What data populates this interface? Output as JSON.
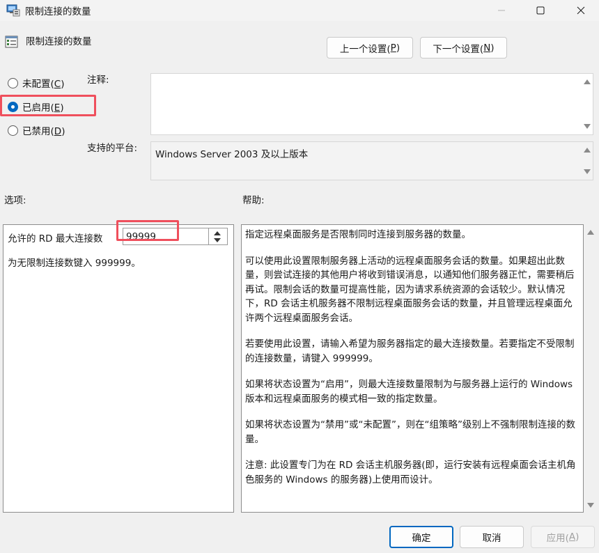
{
  "window": {
    "title": "限制连接的数量"
  },
  "header": {
    "policy_name": "限制连接的数量",
    "prev_button": {
      "label": "上一个设置(",
      "mnemonic": "P",
      "suffix": ")"
    },
    "next_button": {
      "label": "下一个设置(",
      "mnemonic": "N",
      "suffix": ")"
    }
  },
  "state": {
    "options": [
      {
        "label": "未配置(",
        "mnemonic": "C",
        "suffix": ")",
        "selected": false
      },
      {
        "label": "已启用(",
        "mnemonic": "E",
        "suffix": ")",
        "selected": true
      },
      {
        "label": "已禁用(",
        "mnemonic": "D",
        "suffix": ")",
        "selected": false
      }
    ]
  },
  "comment": {
    "label": "注释:",
    "value": ""
  },
  "platform": {
    "label": "支持的平台:",
    "value": "Windows Server 2003 及以上版本"
  },
  "options_section": {
    "label": "选项:",
    "max_connections_label": "允许的 RD 最大连接数",
    "max_connections_value": "99999",
    "hint": "为无限制连接数键入 999999。"
  },
  "help_section": {
    "label": "帮助:",
    "paragraphs": [
      "指定远程桌面服务是否限制同时连接到服务器的数量。",
      "可以使用此设置限制服务器上活动的远程桌面服务会话的数量。如果超出此数量，则尝试连接的其他用户将收到错误消息，以通知他们服务器正忙，需要稍后再试。限制会话的数量可提高性能，因为请求系统资源的会话较少。默认情况下，RD 会话主机服务器不限制远程桌面服务会话的数量，并且管理远程桌面允许两个远程桌面服务会话。",
      "若要使用此设置，请输入希望为服务器指定的最大连接数量。若要指定不受限制的连接数量，请键入 999999。",
      "如果将状态设置为“启用”，则最大连接数量限制为与服务器上运行的 Windows 版本和远程桌面服务的模式相一致的指定数量。",
      "如果将状态设置为“禁用”或“未配置”，则在“组策略”级别上不强制限制连接的数量。",
      "注意: 此设置专门为在 RD 会话主机服务器(即，运行安装有远程桌面会话主机角色服务的 Windows 的服务器)上使用而设计。"
    ]
  },
  "footer": {
    "ok_label": "确定",
    "cancel_label": "取消",
    "apply_label": "应用(",
    "apply_mnemonic": "A",
    "apply_suffix": ")"
  },
  "colors": {
    "accent": "#0067c0",
    "highlight_box": "#ef4f5c"
  }
}
